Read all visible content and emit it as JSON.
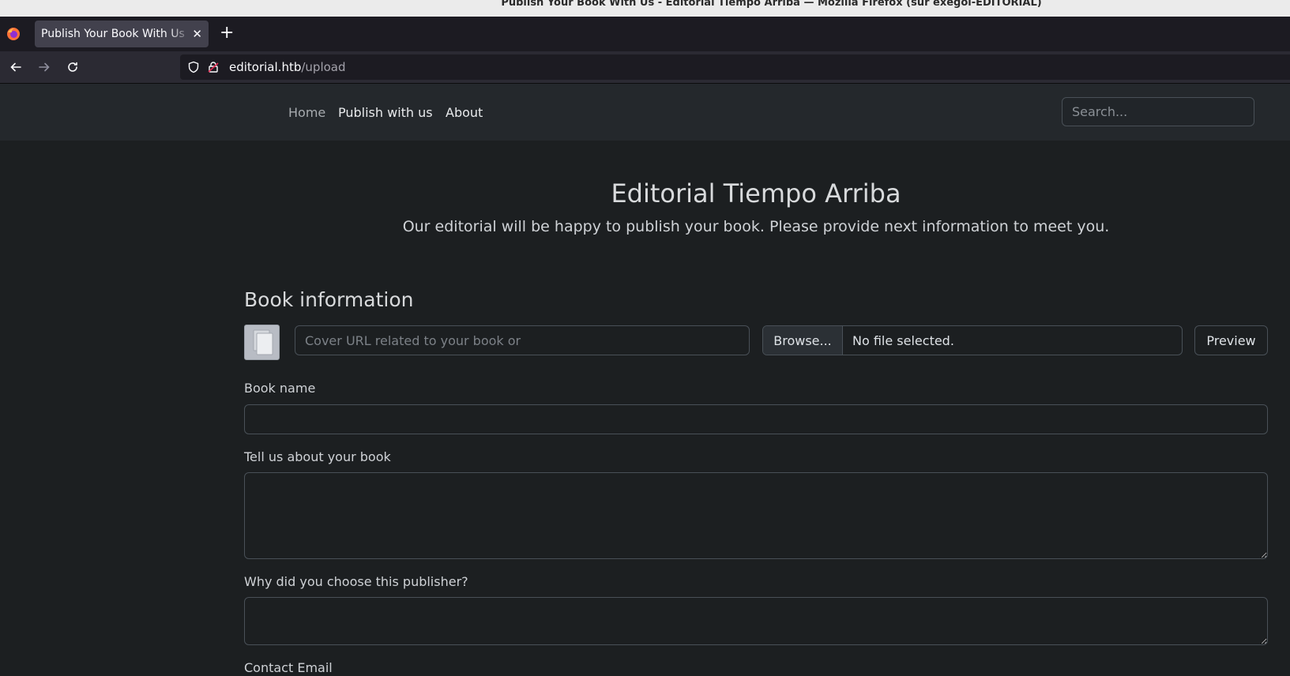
{
  "window": {
    "title": "Publish Your Book With Us - Editorial Tiempo Arriba — Mozilla Firefox (sur exegol-EDITORIAL)"
  },
  "browser": {
    "tab_title": "Publish Your Book With Us",
    "url_host": "editorial.htb",
    "url_path": "/upload"
  },
  "site_nav": {
    "links": [
      "Home",
      "Publish with us",
      "About"
    ],
    "search_placeholder": "Search..."
  },
  "hero": {
    "title": "Editorial Tiempo Arriba",
    "subtitle": "Our editorial will be happy to publish your book. Please provide next information to meet you."
  },
  "form": {
    "section_title": "Book information",
    "cover_url_placeholder": "Cover URL related to your book or",
    "browse_label": "Browse...",
    "file_status": "No file selected.",
    "preview_label": "Preview",
    "book_name_label": "Book name",
    "about_label": "Tell us about your book",
    "why_label": "Why did you choose this publisher?",
    "email_label": "Contact Email"
  }
}
